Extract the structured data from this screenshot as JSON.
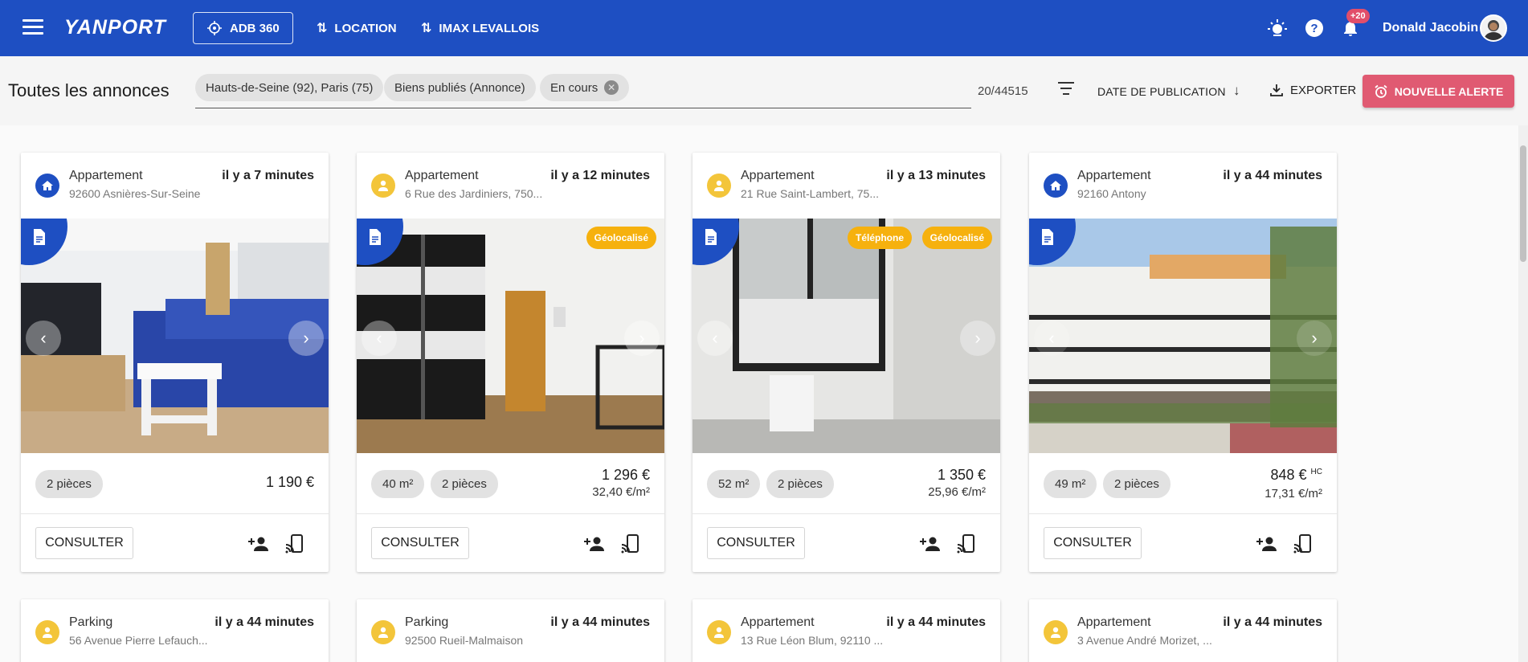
{
  "app": {
    "logo": "YANPORT",
    "nav": [
      {
        "label": "ADB 360"
      },
      {
        "label": "LOCATION"
      },
      {
        "label": "IMAX LEVALLOIS"
      }
    ],
    "notifications_badge": "+20",
    "user_name": "Donald Jacobin"
  },
  "filters": {
    "title": "Toutes les annonces",
    "chips": [
      "Hauts-de-Seine (92), Paris (75)",
      "Biens publiés (Annonce)",
      "En cours"
    ],
    "count": "20/44515",
    "sort_label": "DATE DE PUBLICATION",
    "export_label": "EXPORTER",
    "alert_label": "NOUVELLE ALERTE"
  },
  "colors": {
    "primary": "#1e4fc2",
    "accent": "#e05a72",
    "tag": "#f6b10e",
    "owner_icon": "#f3c53a"
  },
  "cards": [
    {
      "type": "Appartement",
      "address": "92600 Asnières-Sur-Seine",
      "time": "il y a 7 minutes",
      "icon": "home-icon",
      "chips": [
        "2 pièces"
      ],
      "price": "1 190 €",
      "price_sub": "",
      "hc": "",
      "tags": [],
      "consult": "CONSULTER"
    },
    {
      "type": "Appartement",
      "address": "6 Rue des Jardiniers, 750...",
      "time": "il y a 12 minutes",
      "icon": "person-icon",
      "chips": [
        "40 m²",
        "2 pièces"
      ],
      "price": "1 296 €",
      "price_sub": "32,40 €/m²",
      "hc": "",
      "tags": [
        "Géolocalisé"
      ],
      "consult": "CONSULTER"
    },
    {
      "type": "Appartement",
      "address": "21 Rue Saint-Lambert, 75...",
      "time": "il y a 13 minutes",
      "icon": "person-icon",
      "chips": [
        "52 m²",
        "2 pièces"
      ],
      "price": "1 350 €",
      "price_sub": "25,96 €/m²",
      "hc": "",
      "tags": [
        "Téléphone",
        "Géolocalisé"
      ],
      "consult": "CONSULTER"
    },
    {
      "type": "Appartement",
      "address": "92160 Antony",
      "time": "il y a 44 minutes",
      "icon": "home-icon",
      "chips": [
        "49 m²",
        "2 pièces"
      ],
      "price": "848 €",
      "price_sub": "17,31 €/m²",
      "hc": "HC",
      "tags": [],
      "consult": "CONSULTER"
    },
    {
      "type": "Parking",
      "address": "56 Avenue Pierre Lefauch...",
      "time": "il y a 44 minutes",
      "icon": "person-icon"
    },
    {
      "type": "Parking",
      "address": "92500 Rueil-Malmaison",
      "time": "il y a 44 minutes",
      "icon": "person-icon"
    },
    {
      "type": "Appartement",
      "address": "13 Rue Léon Blum, 92110 ...",
      "time": "il y a 44 minutes",
      "icon": "person-icon"
    },
    {
      "type": "Appartement",
      "address": "3 Avenue André Morizet, ...",
      "time": "il y a 44 minutes",
      "icon": "person-icon"
    }
  ]
}
